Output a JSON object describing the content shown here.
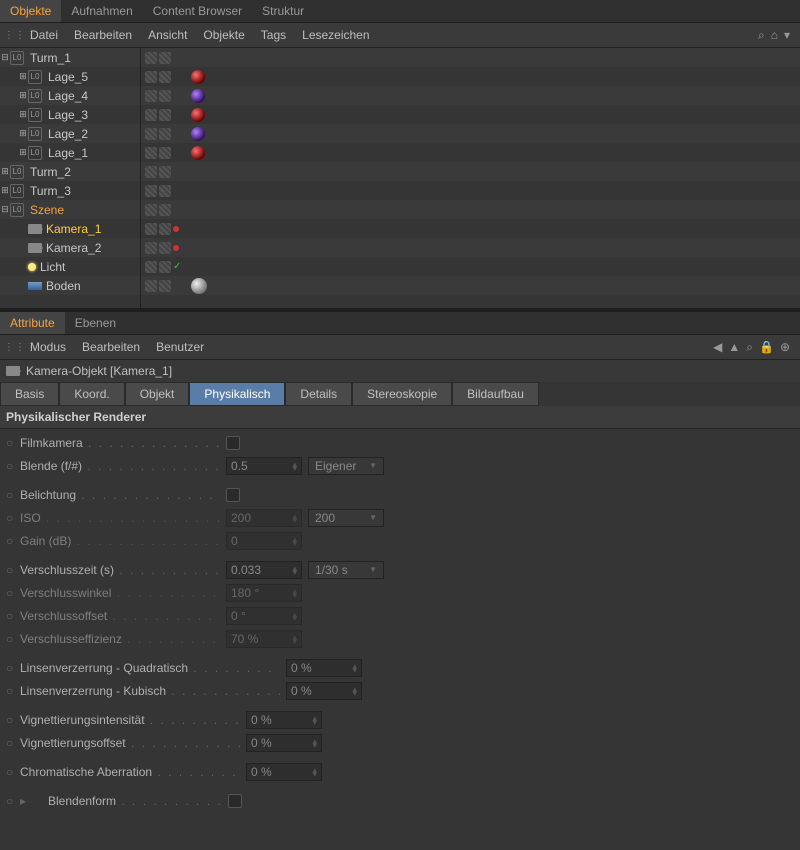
{
  "top_tabs": [
    "Objekte",
    "Aufnahmen",
    "Content Browser",
    "Struktur"
  ],
  "top_menu": [
    "Datei",
    "Bearbeiten",
    "Ansicht",
    "Objekte",
    "Tags",
    "Lesezeichen"
  ],
  "tree": [
    {
      "depth": 0,
      "label": "Turm_1",
      "exp": "-",
      "lo": true
    },
    {
      "depth": 1,
      "label": "Lage_5",
      "exp": "+",
      "lo": true,
      "sphere": "red"
    },
    {
      "depth": 1,
      "label": "Lage_4",
      "exp": "+",
      "lo": true,
      "sphere": "purple"
    },
    {
      "depth": 1,
      "label": "Lage_3",
      "exp": "+",
      "lo": true,
      "sphere": "red"
    },
    {
      "depth": 1,
      "label": "Lage_2",
      "exp": "+",
      "lo": true,
      "sphere": "purple"
    },
    {
      "depth": 1,
      "label": "Lage_1",
      "exp": "+",
      "lo": true,
      "sphere": "red"
    },
    {
      "depth": 0,
      "label": "Turm_2",
      "exp": "+",
      "lo": true
    },
    {
      "depth": 0,
      "label": "Turm_3",
      "exp": "+",
      "lo": true
    },
    {
      "depth": 0,
      "label": "Szene",
      "exp": "-",
      "lo": true,
      "color": "orange"
    },
    {
      "depth": 1,
      "label": "Kamera_1",
      "icon": "cam",
      "color": "yellow",
      "tag": "reddot"
    },
    {
      "depth": 1,
      "label": "Kamera_2",
      "icon": "cam",
      "tag": "reddot"
    },
    {
      "depth": 1,
      "label": "Licht",
      "icon": "light",
      "tag": "check"
    },
    {
      "depth": 1,
      "label": "Boden",
      "icon": "floor",
      "sphere": "grey"
    }
  ],
  "attr_tabs": [
    "Attribute",
    "Ebenen"
  ],
  "attr_menu": [
    "Modus",
    "Bearbeiten",
    "Benutzer"
  ],
  "obj_header": "Kamera-Objekt [Kamera_1]",
  "detail_tabs": [
    "Basis",
    "Koord.",
    "Objekt",
    "Physikalisch",
    "Details",
    "Stereoskopie",
    "Bildaufbau"
  ],
  "section_title": "Physikalischer Renderer",
  "props": {
    "filmkamera": "Filmkamera",
    "blende": "Blende (f/#)",
    "blende_val": "0.5",
    "blende_drop": "Eigener",
    "belichtung": "Belichtung",
    "iso": "ISO",
    "iso_val": "200",
    "iso_drop": "200",
    "gain": "Gain (dB)",
    "gain_val": "0",
    "verschlusszeit": "Verschlusszeit (s)",
    "verschlusszeit_val": "0.033",
    "verschlusszeit_drop": "1/30 s",
    "verschlusswinkel": "Verschlusswinkel",
    "verschlusswinkel_val": "180 °",
    "verschlussoffset": "Verschlussoffset",
    "verschlussoffset_val": "0 °",
    "verschlusseffizienz": "Verschlusseffizienz",
    "verschlusseffizienz_val": "70 %",
    "linsen_quad": "Linsenverzerrung - Quadratisch",
    "linsen_quad_val": "0 %",
    "linsen_kub": "Linsenverzerrung - Kubisch",
    "linsen_kub_val": "0 %",
    "vign_int": "Vignettierungsintensität",
    "vign_int_val": "0 %",
    "vign_off": "Vignettierungsoffset",
    "vign_off_val": "0 %",
    "chrom": "Chromatische Aberration",
    "chrom_val": "0 %",
    "blendenform": "Blendenform"
  }
}
